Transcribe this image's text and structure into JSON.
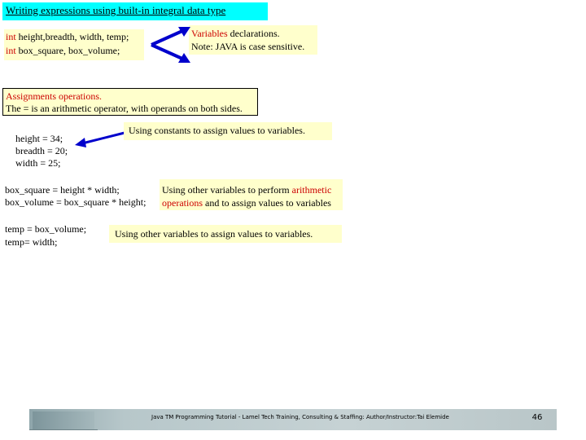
{
  "slide": {
    "title": "Writing expressions using built-in integral data type",
    "declarations": {
      "line1_keyword": "int",
      "line1_rest": " height,breadth, width, temp;",
      "line2_keyword": "int",
      "line2_rest": " box_square, box_volume;"
    },
    "declarations_note": {
      "line1_highlight": "Variables",
      "line1_rest": " declarations.",
      "line2": "Note: JAVA is case sensitive."
    },
    "assignments_box": {
      "line1": "Assignments operations.",
      "line2": "The = is an arithmetic operator, with operands on both sides."
    },
    "constants_code": [
      "height = 34;",
      "breadth = 20;",
      "width = 25;"
    ],
    "constants_note": "Using constants to assign values to variables.",
    "arith_code": [
      "box_square = height * width;",
      "box_volume = box_square * height;"
    ],
    "arith_note": {
      "line1_plain": "Using other variables to perform ",
      "line1_highlight": "arithmetic",
      "line2_highlight": "operations",
      "line2_rest": " and to assign values to variables"
    },
    "temp_code": [
      "temp = box_volume;",
      "temp= width;"
    ],
    "vars_note": "Using other variables to assign values to variables.",
    "footer": {
      "text": "Java TM Programming Tutorial - Lamel Tech Training, Consulting & Staffing: Author/Instructor:Tai Elemide",
      "page_number": "46"
    },
    "colors": {
      "title_bg": "#00ffff",
      "note_bg": "#ffffcc",
      "highlight": "#cc0000",
      "arrow": "#0000cc"
    }
  }
}
